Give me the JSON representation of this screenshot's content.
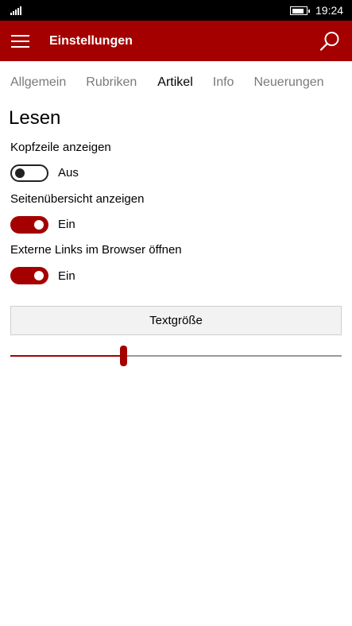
{
  "status_bar": {
    "time": "19:24",
    "signal_icon": "signal-bars-icon",
    "battery_icon": "battery-icon",
    "battery_level": 0.85
  },
  "app_bar": {
    "title": "Einstellungen",
    "menu_icon": "hamburger-menu-icon",
    "search_icon": "search-icon",
    "background_color": "#a50000"
  },
  "tabs": [
    {
      "label": "Allgemein",
      "active": false
    },
    {
      "label": "Rubriken",
      "active": false
    },
    {
      "label": "Artikel",
      "active": true
    },
    {
      "label": "Info",
      "active": false
    },
    {
      "label": "Neuerungen",
      "active": false
    }
  ],
  "section": {
    "title": "Lesen"
  },
  "settings": [
    {
      "label": "Kopfzeile anzeigen",
      "state": "off",
      "state_label": "Aus"
    },
    {
      "label": "Seitenübersicht anzeigen",
      "state": "on",
      "state_label": "Ein"
    },
    {
      "label": "Externe Links im Browser öffnen",
      "state": "on",
      "state_label": "Ein"
    }
  ],
  "text_size": {
    "button_label": "Textgröße",
    "slider_value": 0.34
  },
  "colors": {
    "accent": "#a50000",
    "inactive_tab": "#7a7a7a",
    "slider_track": "#9a9a9a"
  }
}
